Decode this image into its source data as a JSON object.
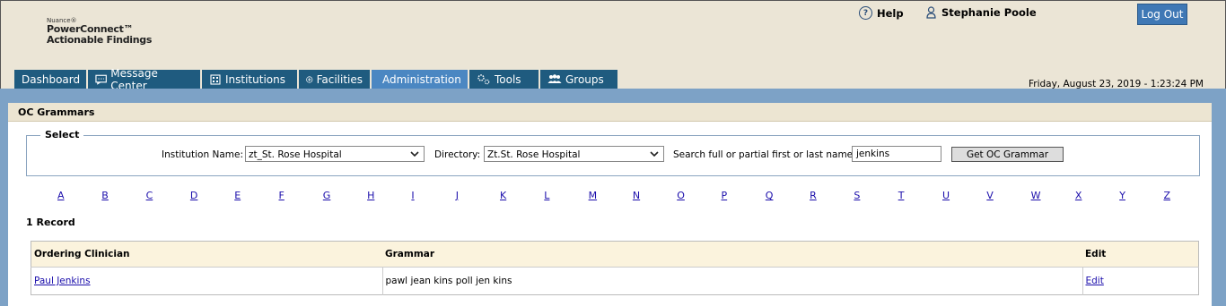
{
  "brand": {
    "vendor": "Nuance®",
    "product_line1": "PowerConnect™",
    "product_line2": "Actionable Findings"
  },
  "header": {
    "help_label": "Help",
    "user_name": "Stephanie Poole",
    "logout_label": "Log Out"
  },
  "tabs": [
    {
      "label": "Dashboard",
      "icon": "none"
    },
    {
      "label": "Message Center",
      "icon": "message-icon"
    },
    {
      "label": "Institutions",
      "icon": "building-icon"
    },
    {
      "label": "Facilities",
      "icon": "plus-circle-icon"
    },
    {
      "label": "Administration",
      "icon": "admin-icon",
      "active": true
    },
    {
      "label": "Tools",
      "icon": "gears-icon"
    },
    {
      "label": "Groups",
      "icon": "group-icon"
    }
  ],
  "datetime": "Friday, August 23, 2019 - 1:23:24 PM",
  "panel": {
    "title": "OC Grammars",
    "select_legend": "Select",
    "institution_label": "Institution Name:",
    "institution_value": "zt_St. Rose Hospital",
    "directory_label": "Directory:",
    "directory_value": "Zt.St. Rose Hospital",
    "search_label": "Search full or partial first or last name:",
    "search_value": "jenkins",
    "get_button": "Get OC Grammar"
  },
  "alphabet": [
    "A",
    "B",
    "C",
    "D",
    "E",
    "F",
    "G",
    "H",
    "I",
    "J",
    "K",
    "L",
    "M",
    "N",
    "O",
    "P",
    "Q",
    "R",
    "S",
    "T",
    "U",
    "V",
    "W",
    "X",
    "Y",
    "Z"
  ],
  "record_count": "1 Record",
  "table": {
    "headers": [
      "Ordering Clinician",
      "Grammar",
      "Edit"
    ],
    "rows": [
      {
        "clinician": "Paul Jenkins",
        "grammar": "pawl jean kins poll jen kins",
        "edit": "Edit"
      }
    ]
  },
  "colors": {
    "tab": "#1f5b7f",
    "tab_active": "#4b87c2",
    "band": "#7da2c6",
    "background": "#ebe5d6"
  }
}
